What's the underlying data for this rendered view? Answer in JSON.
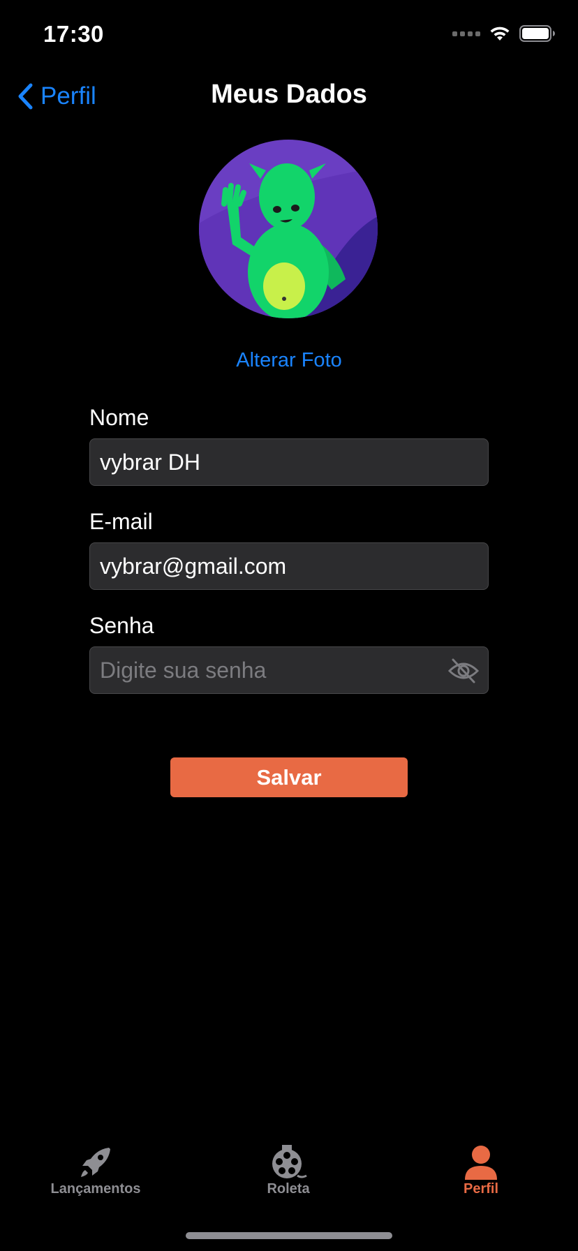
{
  "status_bar": {
    "time": "17:30"
  },
  "nav": {
    "back_label": "Perfil",
    "title": "Meus Dados"
  },
  "profile": {
    "change_photo_label": "Alterar Foto"
  },
  "form": {
    "name_label": "Nome",
    "name_value": "vybrar DH",
    "email_label": "E-mail",
    "email_value": "vybrar@gmail.com",
    "password_label": "Senha",
    "password_placeholder": "Digite sua senha"
  },
  "actions": {
    "save_label": "Salvar"
  },
  "tab_bar": {
    "items": [
      {
        "label": "Lançamentos",
        "icon": "rocket-icon",
        "active": false
      },
      {
        "label": "Roleta",
        "icon": "film-reel-icon",
        "active": false
      },
      {
        "label": "Perfil",
        "icon": "person-icon",
        "active": true
      }
    ]
  },
  "colors": {
    "accent": "#e86a44",
    "link": "#1a84ff",
    "background": "#000000",
    "field_background": "#2c2c2e"
  }
}
